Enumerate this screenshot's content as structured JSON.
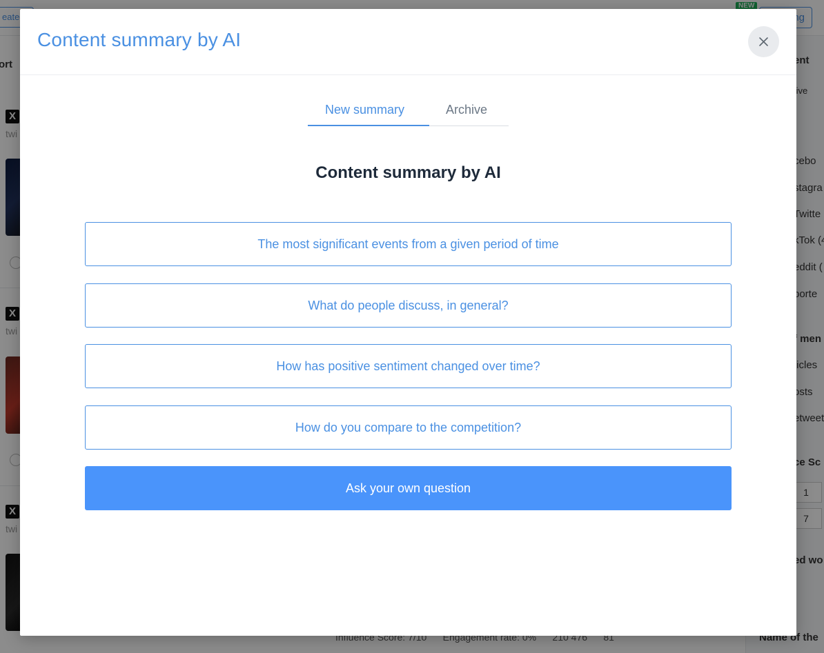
{
  "background": {
    "topbar": {
      "created_label": "eated",
      "new_badge": "NEW",
      "right_button": "ng"
    },
    "sort_label": "ort",
    "posts": [
      {
        "network_icon": "x-logo-icon",
        "network": "X",
        "handle": "twi"
      },
      {
        "network_icon": "x-logo-icon",
        "network": "X",
        "handle": "twi"
      },
      {
        "network_icon": "x-logo-icon",
        "network": "X",
        "handle": "twi"
      }
    ],
    "right_panel": {
      "header": "ent",
      "tab": "tive",
      "sources": [
        "cebo",
        "stagra",
        "Twitte",
        "kTok (4",
        "eddit (",
        "porte"
      ],
      "mentions_header": "f men",
      "mention_types": [
        "ticles",
        "osts",
        "etweet"
      ],
      "score_header": "ce Sc",
      "score_boxes": [
        "1",
        "7"
      ],
      "words_header": "ed wo",
      "name_label": "Name of the"
    },
    "footer": {
      "influence_label": "Influence Score: 7/10",
      "engagement_label": "Engagement rate: 0%",
      "reach": "210 476",
      "views": "81"
    }
  },
  "modal": {
    "title": "Content summary by AI",
    "close_icon": "close-icon",
    "tabs": [
      {
        "label": "New summary",
        "active": true
      },
      {
        "label": "Archive",
        "active": false
      }
    ],
    "section_title": "Content summary by AI",
    "options": [
      "The most significant events from a given period of time",
      "What do people discuss, in general?",
      "How has positive sentiment changed over time?",
      "How do you compare to the competition?"
    ],
    "ask_button": "Ask your own question",
    "colors": {
      "accent": "#4a90e2",
      "primary_button": "#4a94fb",
      "heading": "#1e2a3a"
    }
  }
}
